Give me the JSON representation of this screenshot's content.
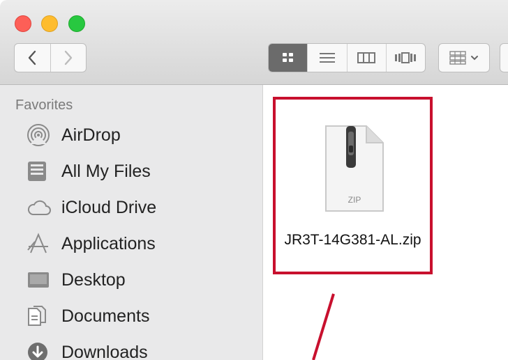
{
  "sidebar": {
    "heading": "Favorites",
    "items": [
      {
        "label": "AirDrop",
        "icon": "airdrop-icon"
      },
      {
        "label": "All My Files",
        "icon": "all-my-files-icon"
      },
      {
        "label": "iCloud Drive",
        "icon": "cloud-icon"
      },
      {
        "label": "Applications",
        "icon": "applications-icon"
      },
      {
        "label": "Desktop",
        "icon": "desktop-icon"
      },
      {
        "label": "Documents",
        "icon": "documents-icon"
      },
      {
        "label": "Downloads",
        "icon": "downloads-icon"
      }
    ]
  },
  "toolbar": {
    "view_modes": [
      "icon",
      "list",
      "column",
      "cover-flow"
    ],
    "active_view": "icon"
  },
  "content": {
    "file": {
      "name": "JR3T-14G381-AL.zip",
      "type_label": "ZIP",
      "highlight_color": "#c8102e"
    }
  }
}
